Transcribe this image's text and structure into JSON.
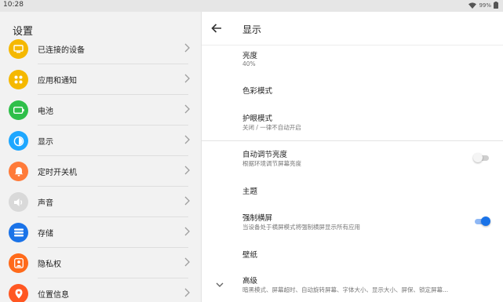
{
  "status": {
    "time": "10:28",
    "battery": "99%"
  },
  "left_panel": {
    "title": "设置",
    "items": [
      {
        "label": "已连接的设备",
        "icon": "connected-devices-icon",
        "color": "#f5b800"
      },
      {
        "label": "应用和通知",
        "icon": "apps-icon",
        "color": "#f5b800"
      },
      {
        "label": "电池",
        "icon": "battery-icon",
        "color": "#2fbf4a"
      },
      {
        "label": "显示",
        "icon": "display-icon",
        "color": "#1ea7ff"
      },
      {
        "label": "定时开关机",
        "icon": "power-schedule-icon",
        "color": "#ff7b3a"
      },
      {
        "label": "声音",
        "icon": "sound-icon",
        "color": "#d9d9d9"
      },
      {
        "label": "存储",
        "icon": "storage-icon",
        "color": "#1a73e8"
      },
      {
        "label": "隐私权",
        "icon": "privacy-icon",
        "color": "#ff6a1a"
      },
      {
        "label": "位置信息",
        "icon": "location-icon",
        "color": "#ff5722"
      }
    ]
  },
  "right_panel": {
    "title": "显示",
    "rows": {
      "brightness": {
        "title": "亮度",
        "subtitle": "40%"
      },
      "color_mode": {
        "title": "色彩模式"
      },
      "eye_care": {
        "title": "护眼模式",
        "subtitle": "关闭 / 一律不自动开启"
      },
      "auto_brightness": {
        "title": "自动调节亮度",
        "subtitle": "根据环境调节屏幕亮度",
        "enabled": false
      },
      "theme": {
        "title": "主题"
      },
      "force_landscape": {
        "title": "强制横屏",
        "subtitle": "当设备处于横屏模式将强制横屏显示所有应用",
        "enabled": true
      },
      "wallpaper": {
        "title": "壁纸"
      },
      "advanced": {
        "title": "高级",
        "subtitle": "暗黑模式、屏幕超时、自动旋转屏幕、字体大小、显示大小、屏保、锁定屏幕..."
      }
    }
  },
  "colors": {
    "accent": "#1a73e8",
    "switch_on_track": "#8fb8f5",
    "switch_off_track": "#cfcfcf"
  }
}
